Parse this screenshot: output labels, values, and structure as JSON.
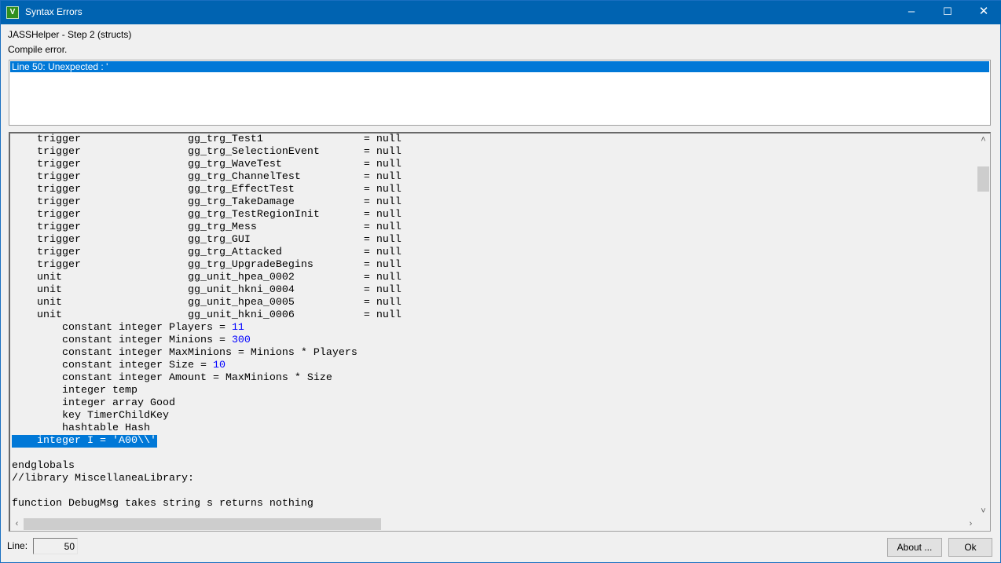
{
  "window": {
    "title": "Syntax Errors",
    "icon": "vjass-icon",
    "minimize": "–",
    "maximize": "☐",
    "close": "✕"
  },
  "header": {
    "step": "JASSHelper - Step 2 (structs)",
    "status": "Compile error."
  },
  "errors": [
    "Line 50: Unexpected : '"
  ],
  "code_lines": [
    [
      [
        "    trigger                 gg_trg_Test1                = null",
        "t"
      ]
    ],
    [
      [
        "    trigger                 gg_trg_SelectionEvent       = null",
        "t"
      ]
    ],
    [
      [
        "    trigger                 gg_trg_WaveTest             = null",
        "t"
      ]
    ],
    [
      [
        "    trigger                 gg_trg_ChannelTest          = null",
        "t"
      ]
    ],
    [
      [
        "    trigger                 gg_trg_EffectTest           = null",
        "t"
      ]
    ],
    [
      [
        "    trigger                 gg_trg_TakeDamage           = null",
        "t"
      ]
    ],
    [
      [
        "    trigger                 gg_trg_TestRegionInit       = null",
        "t"
      ]
    ],
    [
      [
        "    trigger                 gg_trg_Mess                 = null",
        "t"
      ]
    ],
    [
      [
        "    trigger                 gg_trg_GUI                  = null",
        "t"
      ]
    ],
    [
      [
        "    trigger                 gg_trg_Attacked             = null",
        "t"
      ]
    ],
    [
      [
        "    trigger                 gg_trg_UpgradeBegins        = null",
        "t"
      ]
    ],
    [
      [
        "    unit                    gg_unit_hpea_0002           = null",
        "t"
      ]
    ],
    [
      [
        "    unit                    gg_unit_hkni_0004           = null",
        "t"
      ]
    ],
    [
      [
        "    unit                    gg_unit_hpea_0005           = null",
        "t"
      ]
    ],
    [
      [
        "    unit                    gg_unit_hkni_0006           = null",
        "t"
      ]
    ],
    [
      [
        "        constant integer Players = ",
        "t"
      ],
      [
        "11",
        "n"
      ]
    ],
    [
      [
        "        constant integer Minions = ",
        "t"
      ],
      [
        "300",
        "n"
      ]
    ],
    [
      [
        "        constant integer MaxMinions = Minions * Players",
        "t"
      ]
    ],
    [
      [
        "        constant integer Size = ",
        "t"
      ],
      [
        "10",
        "n"
      ]
    ],
    [
      [
        "        constant integer Amount = MaxMinions * Size",
        "t"
      ]
    ],
    [
      [
        "        integer temp",
        "t"
      ]
    ],
    [
      [
        "        integer array Good",
        "t"
      ]
    ],
    [
      [
        "        key TimerChildKey",
        "t"
      ]
    ],
    [
      [
        "        hashtable Hash",
        "t"
      ]
    ],
    [
      [
        "    integer I = 'A00\\\\'",
        "s"
      ]
    ],
    [
      [
        "",
        "t"
      ]
    ],
    [
      [
        "endglobals",
        "t"
      ]
    ],
    [
      [
        "//library MiscellaneaLibrary:",
        "t"
      ]
    ],
    [
      [
        "",
        "t"
      ]
    ],
    [
      [
        "function DebugMsg takes string s returns nothing",
        "t"
      ]
    ]
  ],
  "footer": {
    "line_label": "Line:",
    "line_value": "50",
    "about": "About ...",
    "ok": "Ok"
  }
}
